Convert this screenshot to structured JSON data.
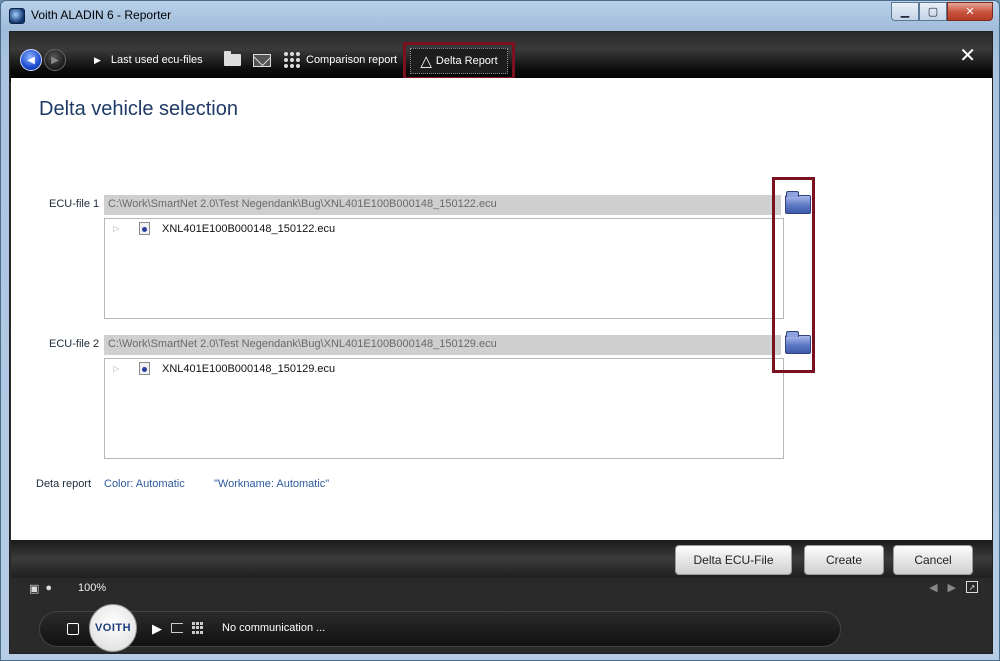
{
  "window": {
    "title": "Voith ALADIN 6 - Reporter",
    "minimize_icon": "minimize-icon",
    "maximize_icon": "maximize-icon",
    "close_icon": "close-icon"
  },
  "toolbar": {
    "last_used": "Last used ecu-files",
    "comparison_report": "Comparison report",
    "delta_report": "Delta Report",
    "close_glyph": "✕"
  },
  "page": {
    "title": "Delta vehicle selection"
  },
  "ecu_files": [
    {
      "label": "ECU-file 1",
      "path": "C:\\Work\\SmartNet 2.0\\Test Negendank\\Bug\\XNL401E100B000148_150122.ecu",
      "tree_item": "XNL401E100B000148_150122.ecu"
    },
    {
      "label": "ECU-file 2",
      "path": "C:\\Work\\SmartNet 2.0\\Test Negendank\\Bug\\XNL401E100B000148_150129.ecu",
      "tree_item": "XNL401E100B000148_150129.ecu"
    }
  ],
  "report": {
    "label": "Deta report",
    "color": "Color: Automatic",
    "workname": "\"Workname: Automatic\""
  },
  "actions": {
    "delta_ecu_file": "Delta ECU-File",
    "create": "Create",
    "cancel": "Cancel"
  },
  "status": {
    "zoom": "100%"
  },
  "dock": {
    "logo": "VOITH",
    "communication": "No communication ..."
  },
  "colors": {
    "highlight": "#7a1020",
    "title": "#1f3a66",
    "link": "#2c5a9c"
  }
}
